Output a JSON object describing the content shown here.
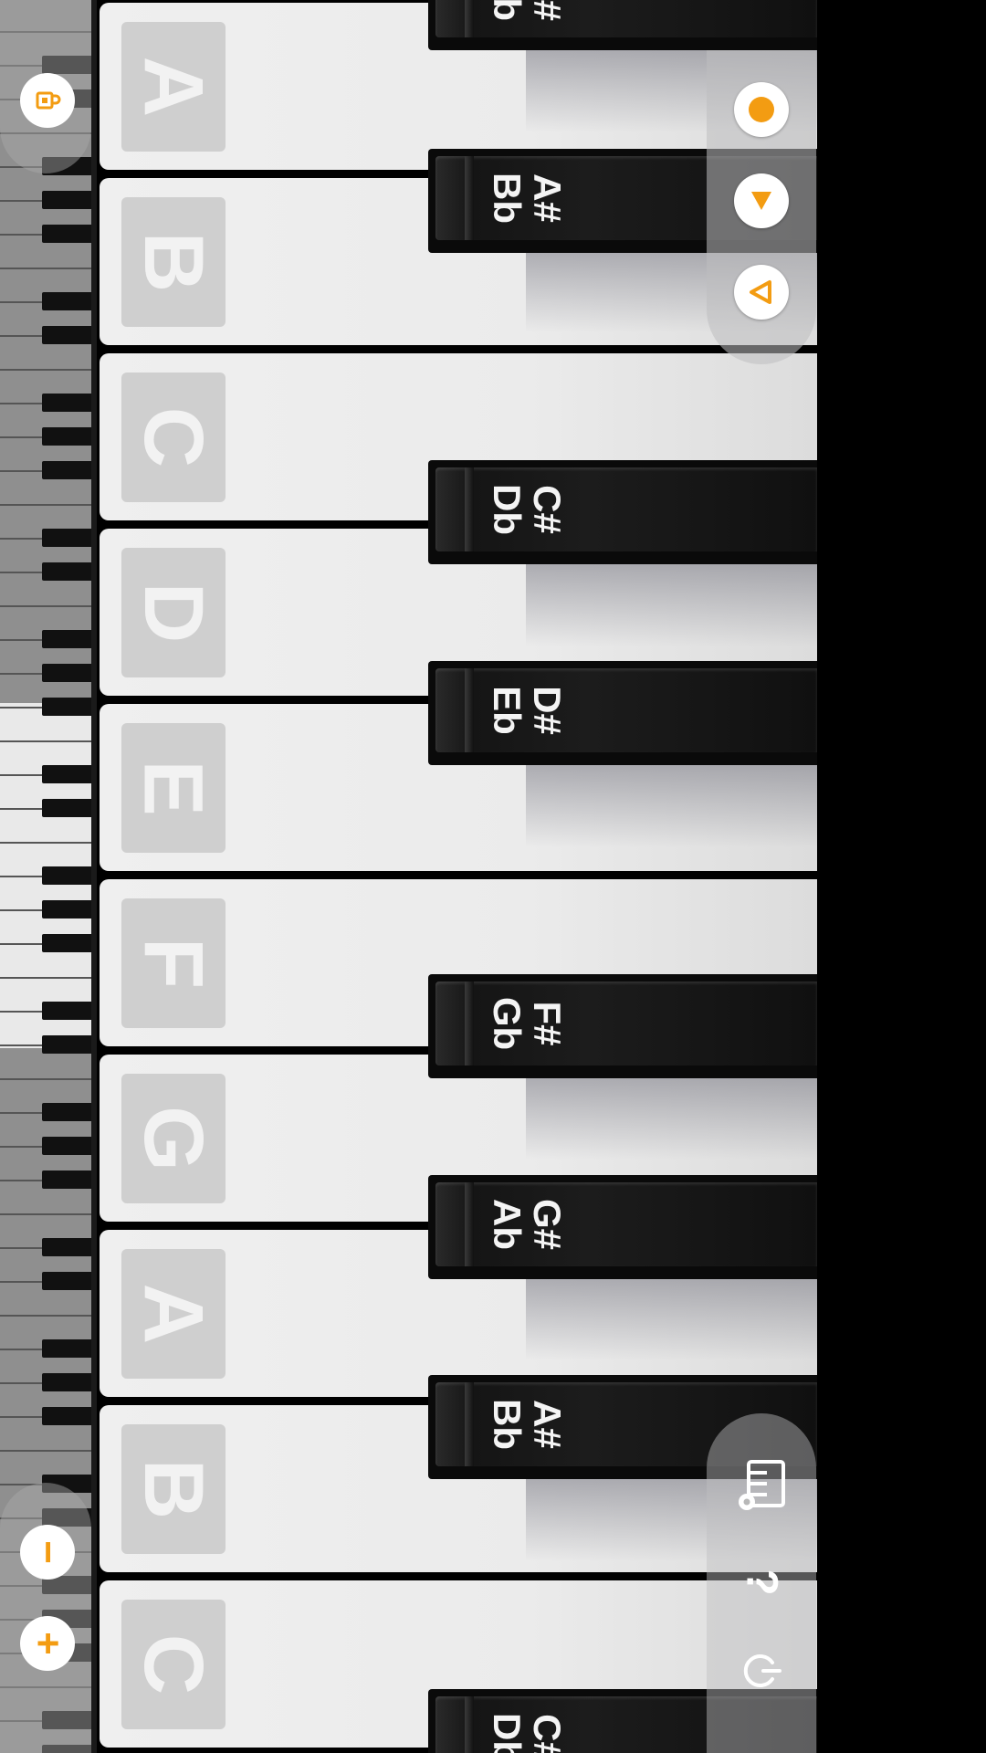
{
  "white_keys": [
    {
      "note": "A"
    },
    {
      "note": "B"
    },
    {
      "note": "C"
    },
    {
      "note": "D"
    },
    {
      "note": "E"
    },
    {
      "note": "F"
    },
    {
      "note": "G"
    },
    {
      "note": "A"
    },
    {
      "note": "B"
    },
    {
      "note": "C"
    }
  ],
  "black_keys": [
    {
      "sharp": "G#",
      "flat": "Ab"
    },
    {
      "sharp": "A#",
      "flat": "Bb"
    },
    {
      "sharp": "C#",
      "flat": "Db"
    },
    {
      "sharp": "D#",
      "flat": "Eb"
    },
    {
      "sharp": "F#",
      "flat": "Gb"
    },
    {
      "sharp": "G#",
      "flat": "Ab"
    },
    {
      "sharp": "A#",
      "flat": "Bb"
    },
    {
      "sharp": "C#",
      "flat": "Db"
    }
  ],
  "controls": {
    "record_icon": "record-dot-icon",
    "open_icon": "triangle-down-icon",
    "play_icon": "play-outline-icon",
    "keyboard_settings_icon": "keyboard-settings-icon",
    "help_icon": "question-mark-icon",
    "power_icon": "power-icon",
    "rotate_icon": "rotate-lock-icon",
    "zoom_out_label": "−",
    "zoom_in_label": "+"
  },
  "colors": {
    "accent": "#f39c12",
    "white_key": "#ebebeb",
    "black_key": "#111111"
  }
}
